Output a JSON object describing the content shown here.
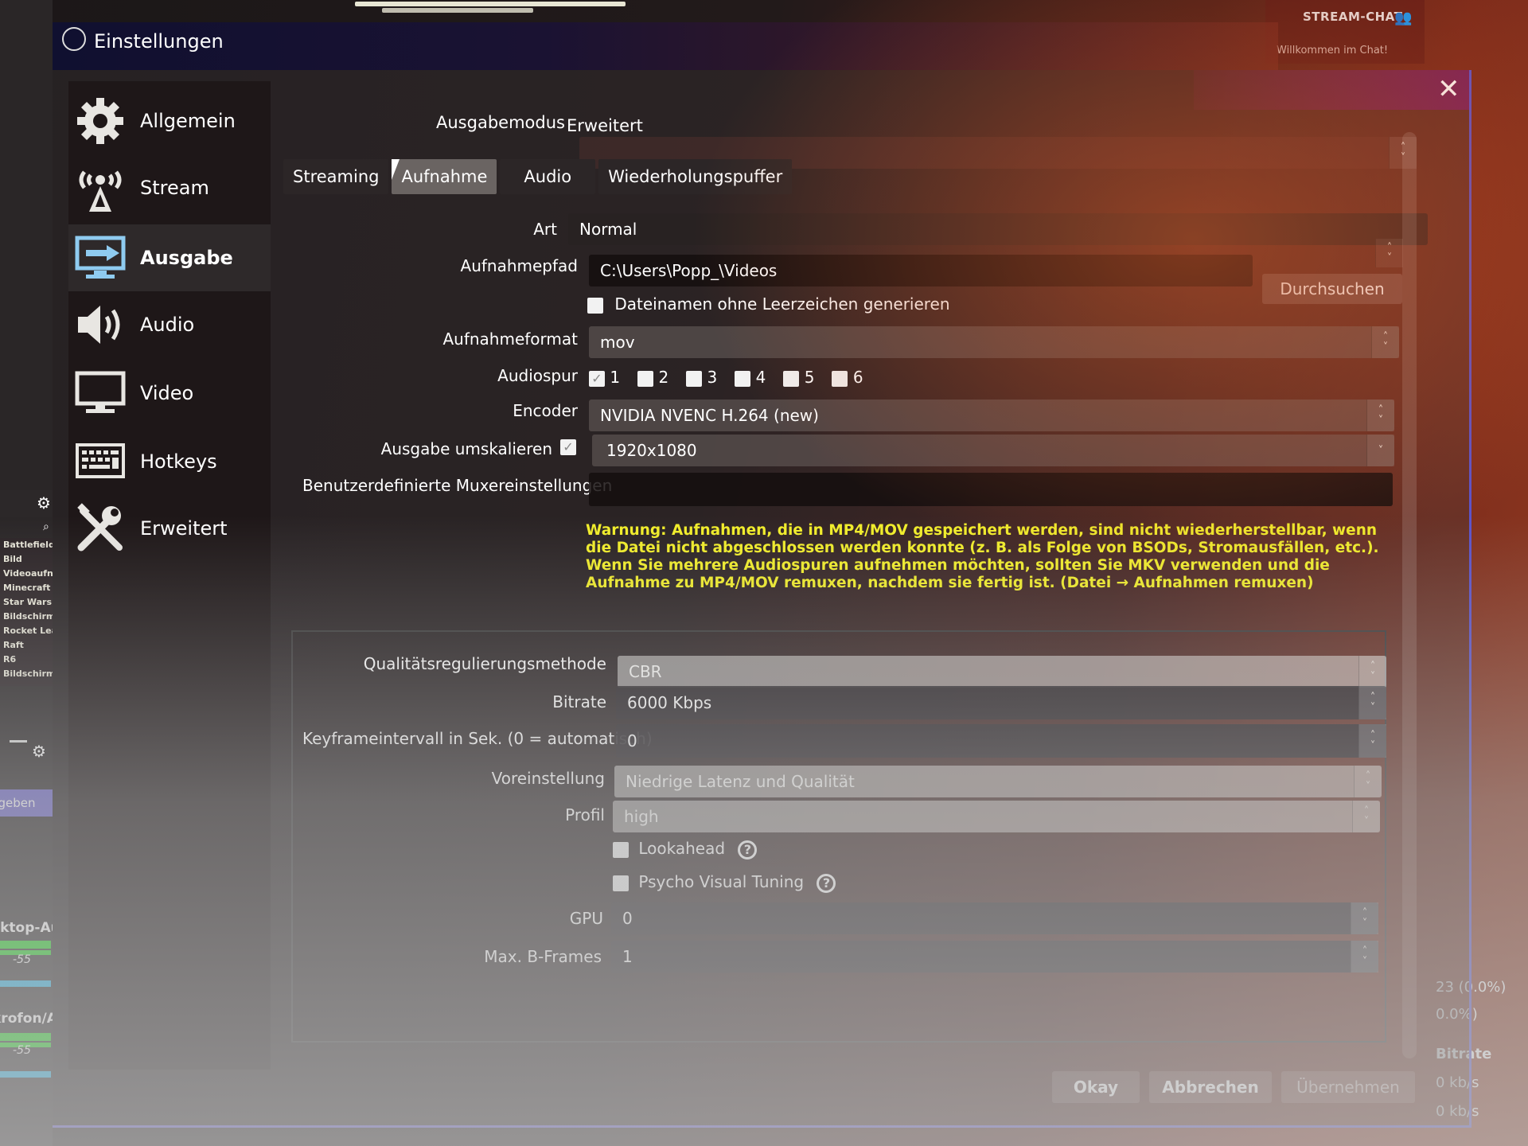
{
  "background": {
    "scene_list": [
      "Battlefield",
      "Bild",
      "Videoaufna",
      "Minecraft",
      "Star Wars",
      "Bildschirma",
      "Rocket Lea",
      "Raft",
      "R6",
      "Bildschirma"
    ],
    "blue_button_label": "ngeben",
    "mixer": [
      {
        "label": "sktop-Au",
        "scale": "-55"
      },
      {
        "label": "krofon/A",
        "scale": "-55"
      }
    ],
    "chat": {
      "title": "STREAM-CHAT",
      "welcome": "Willkommen im Chat!"
    },
    "stats": {
      "line1": "23 (0.0%)",
      "line2": "0.0%)",
      "bitrate_header": "Bitrate",
      "bitrate_values": [
        "0 kb/s",
        "0 kb/s"
      ]
    }
  },
  "dialog": {
    "title": "Einstellungen",
    "close_label": "✕",
    "sidebar": [
      {
        "label": "Allgemein",
        "icon": "gear-icon"
      },
      {
        "label": "Stream",
        "icon": "antenna-icon"
      },
      {
        "label": "Ausgabe",
        "icon": "output-monitor-icon",
        "active": true
      },
      {
        "label": "Audio",
        "icon": "speaker-icon"
      },
      {
        "label": "Video",
        "icon": "monitor-icon"
      },
      {
        "label": "Hotkeys",
        "icon": "keyboard-icon"
      },
      {
        "label": "Erweitert",
        "icon": "tools-icon"
      }
    ],
    "output_mode": {
      "label": "Ausgabemodus",
      "value": "Erweitert"
    },
    "tabs": [
      {
        "label": "Streaming"
      },
      {
        "label": "Aufnahme",
        "active": true
      },
      {
        "label": "Audio"
      },
      {
        "label": "Wiederholungspuffer"
      }
    ],
    "recording": {
      "type": {
        "label": "Art",
        "value": "Normal"
      },
      "path": {
        "label": "Aufnahmepfad",
        "value": "C:\\Users\\Popp_\\Videos",
        "browse_label": "Durchsuchen"
      },
      "no_spaces": {
        "label": "Dateinamen ohne Leerzeichen generieren",
        "checked": false
      },
      "format": {
        "label": "Aufnahmeformat",
        "value": "mov"
      },
      "audio_tracks": {
        "label": "Audiospur",
        "tracks": [
          {
            "n": "1",
            "checked": true
          },
          {
            "n": "2",
            "checked": false
          },
          {
            "n": "3",
            "checked": false
          },
          {
            "n": "4",
            "checked": false
          },
          {
            "n": "5",
            "checked": false
          },
          {
            "n": "6",
            "checked": false
          }
        ]
      },
      "encoder": {
        "label": "Encoder",
        "value": "NVIDIA NVENC H.264 (new)"
      },
      "rescale": {
        "label": "Ausgabe umskalieren",
        "checked": true,
        "value": "1920x1080"
      },
      "muxer": {
        "label": "Benutzerdefinierte Muxereinstellungen",
        "value": ""
      },
      "warning": "Warnung: Aufnahmen, die in MP4/MOV gespeichert werden, sind nicht wiederherstellbar, wenn die Datei nicht abgeschlossen werden konnte (z. B. als Folge von BSODs, Stromausfällen, etc.). Wenn Sie mehrere Audiospuren aufnehmen möchten, sollten Sie MKV verwenden und die Aufnahme zu MP4/MOV remuxen, nachdem sie fertig ist. (Datei → Aufnahmen remuxen)"
    },
    "encoder_settings": {
      "rate_control": {
        "label": "Qualitätsregulierungsmethode",
        "value": "CBR"
      },
      "bitrate": {
        "label": "Bitrate",
        "value": "6000 Kbps"
      },
      "keyframe": {
        "label": "Keyframeintervall in Sek. (0 = automatisch)",
        "value": "0"
      },
      "preset": {
        "label": "Voreinstellung",
        "value": "Niedrige Latenz und Qualität"
      },
      "profile": {
        "label": "Profil",
        "value": "high"
      },
      "lookahead": {
        "label": "Lookahead",
        "checked": false
      },
      "psycho_visual": {
        "label": "Psycho Visual Tuning",
        "checked": false
      },
      "gpu": {
        "label": "GPU",
        "value": "0"
      },
      "bframes": {
        "label": "Max. B-Frames",
        "value": "1"
      }
    },
    "footer": {
      "ok": "Okay",
      "cancel": "Abbrechen",
      "apply": "Übernehmen"
    }
  }
}
